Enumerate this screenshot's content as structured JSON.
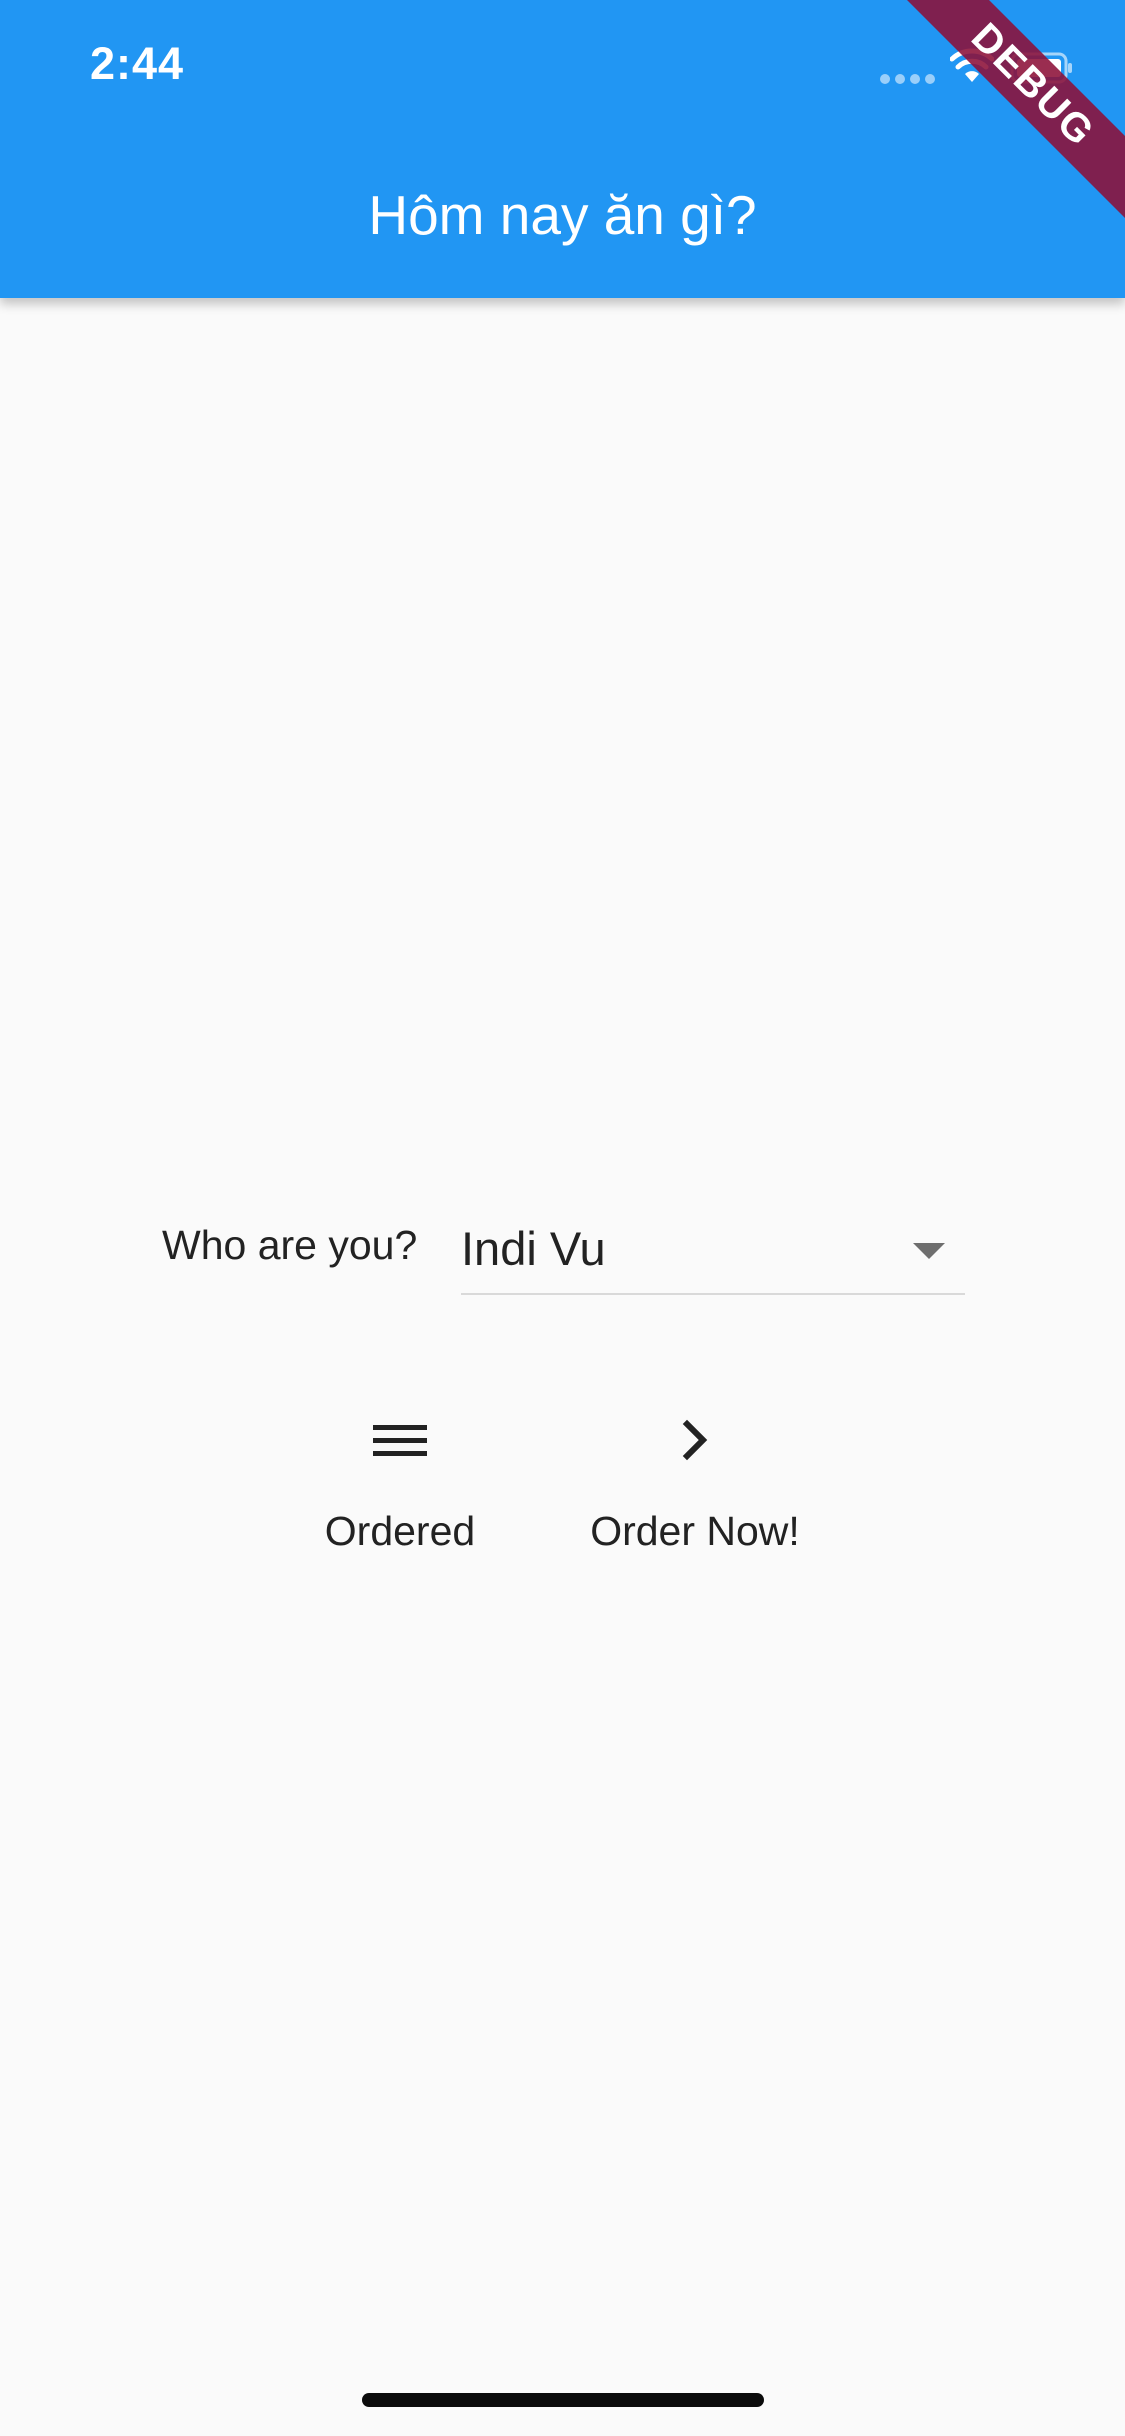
{
  "status_bar": {
    "time": "2:44",
    "icons": [
      "cellular-dots-icon",
      "wifi-icon",
      "battery-icon"
    ]
  },
  "debug_banner": {
    "label": "DEBUG",
    "color": "#8c1038"
  },
  "app_bar": {
    "title": "Hôm nay ăn gì?",
    "background": "#2196f3"
  },
  "form": {
    "who_label": "Who are you?",
    "selected_user": "Indi Vu"
  },
  "actions": {
    "ordered": {
      "label": "Ordered",
      "icon": "menu-icon"
    },
    "order_now": {
      "label": "Order Now!",
      "icon": "chevron-right-icon"
    }
  },
  "colors": {
    "primary": "#2196f3",
    "background": "#fafafa",
    "text": "#222222"
  }
}
